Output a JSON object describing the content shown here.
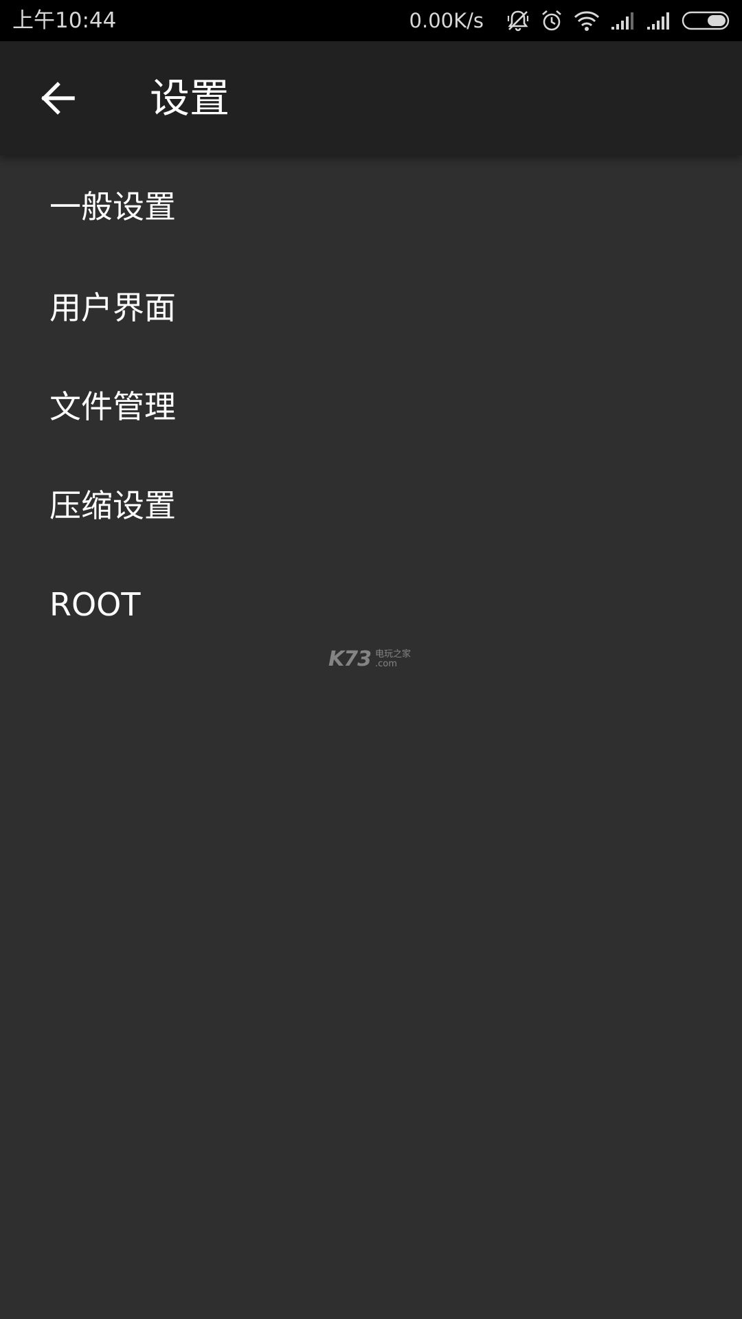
{
  "status_bar": {
    "time": "上午10:44",
    "net_speed": "0.00K/s",
    "icons": [
      "mute-notification-icon",
      "alarm-icon",
      "wifi-icon",
      "signal-1-icon",
      "signal-2-icon",
      "battery-icon"
    ]
  },
  "app_bar": {
    "back_icon": "arrow-back-icon",
    "title": "设置"
  },
  "settings": {
    "items": [
      {
        "label": "一般设置"
      },
      {
        "label": "用户界面"
      },
      {
        "label": "文件管理"
      },
      {
        "label": "压缩设置"
      },
      {
        "label": "ROOT"
      }
    ]
  },
  "watermark": {
    "logo": "K73",
    "line1": "电玩之家",
    "line2": ".com"
  },
  "colors": {
    "status_bar_bg": "#000000",
    "app_bar_bg": "#212121",
    "content_bg": "#2f2f2f",
    "text_primary": "#ffffff"
  }
}
